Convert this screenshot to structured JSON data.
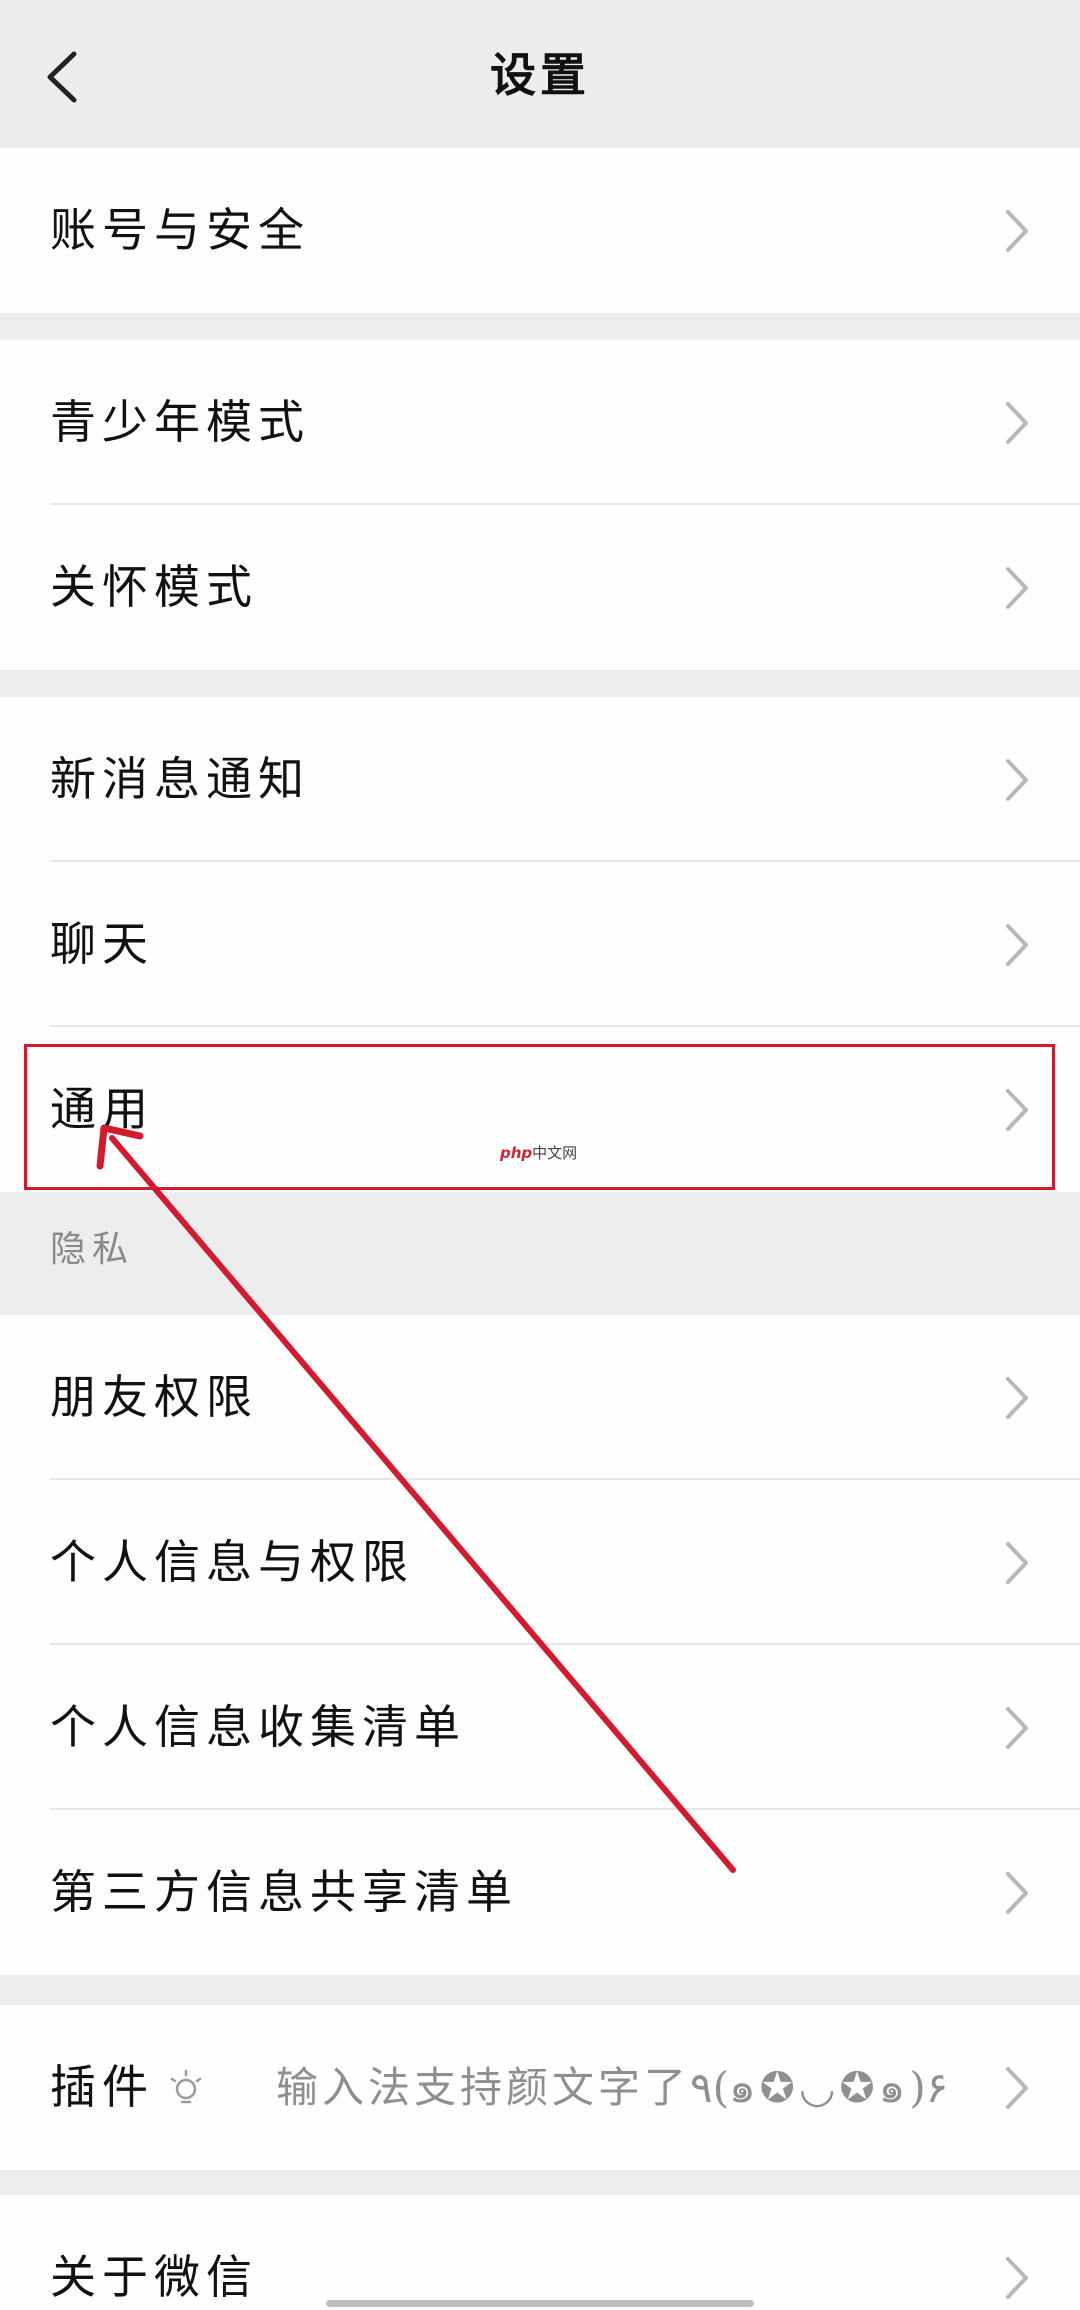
{
  "header": {
    "title": "设置",
    "back_icon": "chevron-left-icon"
  },
  "groups": {
    "account": {
      "items": [
        {
          "label": "账号与安全"
        }
      ]
    },
    "modes": {
      "items": [
        {
          "label": "青少年模式"
        },
        {
          "label": "关怀模式"
        }
      ]
    },
    "general": {
      "items": [
        {
          "label": "新消息通知"
        },
        {
          "label": "聊天"
        },
        {
          "label": "通用"
        }
      ]
    },
    "privacy": {
      "title": "隐私",
      "items": [
        {
          "label": "朋友权限"
        },
        {
          "label": "个人信息与权限"
        },
        {
          "label": "个人信息收集清单"
        },
        {
          "label": "第三方信息共享清单"
        }
      ]
    },
    "plugins": {
      "label": "插件",
      "icon": "lightbulb-icon",
      "status": "输入法支持颜文字了٩(๑✪◡✪๑)۶"
    },
    "about": {
      "items": [
        {
          "label": "关于微信"
        }
      ]
    }
  },
  "watermark": {
    "brand": "php",
    "text": "中文网"
  },
  "annotation": {
    "highlight_color": "#d31a2e",
    "target": "通用"
  }
}
